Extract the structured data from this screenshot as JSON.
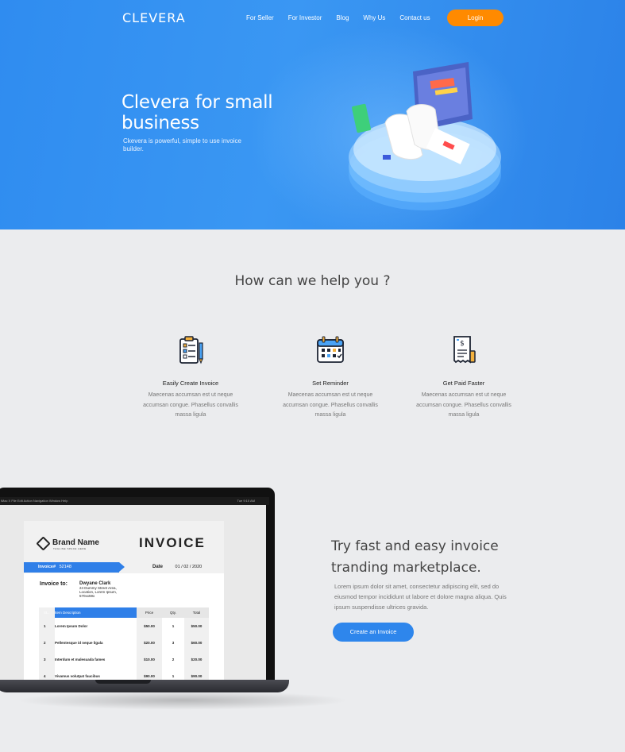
{
  "header": {
    "logo": "CLEVERA",
    "nav": [
      "For Seller",
      "For Investor",
      "Blog",
      "Why Us",
      "Contact us"
    ],
    "login_label": "Login",
    "accent_color": "#ff8a00"
  },
  "hero": {
    "title": "Clevera for small business",
    "subtitle": "Ckevera is powerful, simple to use invoice builder.",
    "background_color": "#2f8cf0"
  },
  "help": {
    "title": "How can we help you ?",
    "features": [
      {
        "icon": "clipboard-checklist-icon",
        "title": "Easily Create Invoice",
        "text": "Maecenas accumsan est ut neque accumsan congue. Phasellus convallis massa ligula"
      },
      {
        "icon": "calendar-icon",
        "title": "Set Reminder",
        "text": "Maecenas accumsan est ut neque accumsan congue. Phasellus convallis massa ligula"
      },
      {
        "icon": "receipt-dollar-icon",
        "title": "Get Paid Faster",
        "text": "Maecenas accumsan est ut neque accumsan congue. Phasellus convallis massa ligula"
      }
    ]
  },
  "laptop": {
    "menubar": "iMac X   File   Edit   Action   Navigation   Window   Help",
    "menubar_right": "Tue 9:10 AM",
    "invoice": {
      "brand_name": "Brand Name",
      "brand_tagline": "TAGLINE SPACE HERE",
      "heading": "INVOICE",
      "number_label": "Invoice#",
      "number": "52148",
      "date_label": "Date",
      "date": "01 / 02 / 2020",
      "to_label": "Invoice to:",
      "to_name": "Dwyane Clark",
      "to_address_1": "24 Dummy Street Area,",
      "to_address_2": "Location, Lorem Ipsum,",
      "to_address_3": "570xx59x",
      "columns": [
        "SL.",
        "Item Description",
        "Price",
        "Qty.",
        "Total"
      ],
      "rows": [
        [
          "1",
          "Lorem Ipsum Dolor",
          "$50.00",
          "1",
          "$50.00"
        ],
        [
          "2",
          "Pellentesque id neque ligula",
          "$20.00",
          "3",
          "$60.00"
        ],
        [
          "3",
          "Interdum et malesuada fames",
          "$10.00",
          "2",
          "$20.00"
        ],
        [
          "4",
          "Vivamus volutpat faucibus",
          "$90.00",
          "1",
          "$90.00"
        ]
      ]
    }
  },
  "promo": {
    "title": "Try fast and easy invoice tranding marketplace.",
    "text": "Lorem ipsum dolor sit amet, consectetur adipiscing elit, sed do eiusmod tempor incididunt ut labore et dolore magna aliqua. Quis ipsum suspendisse ultrices gravida.",
    "button_label": "Create an Invoice"
  }
}
